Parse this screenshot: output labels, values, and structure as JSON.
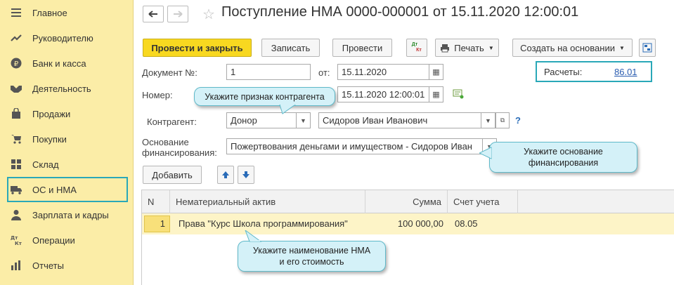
{
  "sidebar": {
    "items": [
      {
        "label": "Главное",
        "icon": "menu-icon"
      },
      {
        "label": "Руководителю",
        "icon": "trend-icon"
      },
      {
        "label": "Банк и касса",
        "icon": "ruble-icon"
      },
      {
        "label": "Деятельность",
        "icon": "handshake-icon"
      },
      {
        "label": "Продажи",
        "icon": "bag-icon"
      },
      {
        "label": "Покупки",
        "icon": "cart-icon"
      },
      {
        "label": "Склад",
        "icon": "grid-icon"
      },
      {
        "label": "ОС и НМА",
        "icon": "truck-icon"
      },
      {
        "label": "Зарплата и кадры",
        "icon": "person-icon"
      },
      {
        "label": "Операции",
        "icon": "dt-kt-icon"
      },
      {
        "label": "Отчеты",
        "icon": "bar-chart-icon"
      }
    ],
    "active_index": 7
  },
  "header": {
    "title": "Поступление НМА 0000-000001 от 15.11.2020 12:00:01"
  },
  "toolbar": {
    "post_close": "Провести и закрыть",
    "save": "Записать",
    "post": "Провести",
    "dt_kt_top": "Дт",
    "dt_kt_bottom": "Кт",
    "print": "Печать",
    "create_based": "Создать на основании"
  },
  "form": {
    "doc_no_label": "Документ №:",
    "doc_no_value": "1",
    "from_label": "от:",
    "date_value": "15.11.2020",
    "number_label": "Номер:",
    "number_date_value": "15.11.2020 12:00:01",
    "contractor_label": "Контрагент:",
    "contractor_type": "Донор",
    "contractor_name": "Сидоров Иван Иванович",
    "help": "?",
    "basis_label_1": "Основание",
    "basis_label_2": "финансирования:",
    "basis_value": "Пожертвования деньгами и имуществом - Сидоров Иван"
  },
  "payments": {
    "label": "Расчеты:",
    "value": "86.01"
  },
  "table_toolbar": {
    "add": "Добавить"
  },
  "table": {
    "headers": [
      "N",
      "Нематериальный актив",
      "Сумма",
      "Счет учета"
    ],
    "rows": [
      {
        "n": "1",
        "asset": "Права \"Курс Школа программирования\"",
        "sum": "100 000,00",
        "account": "08.05"
      }
    ]
  },
  "callouts": {
    "contractor": "Укажите признак контрагента",
    "basis_1": "Укажите основание",
    "basis_2": "финансирования",
    "nma_1": "Укажите наименование НМА",
    "nma_2": "и его стоимость"
  }
}
